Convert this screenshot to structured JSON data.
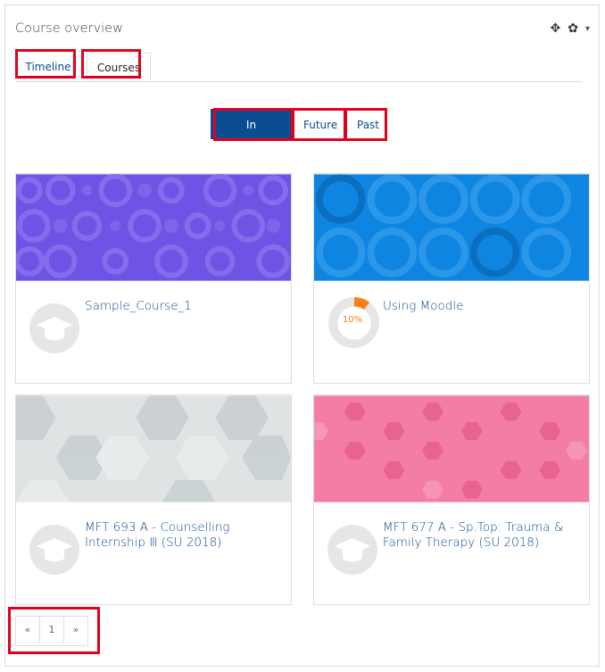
{
  "block": {
    "title": "Course overview",
    "controls": {
      "move_icon": "✥",
      "gear_icon": "✿",
      "caret_icon": "▾"
    }
  },
  "tabs": [
    {
      "label": "Timeline"
    },
    {
      "label": "Courses"
    }
  ],
  "filters": {
    "in_progress": "In progress",
    "future": "Future",
    "past": "Past"
  },
  "courses": [
    {
      "name": "Sample_Course_1",
      "theme": "purple",
      "progress_percent": null
    },
    {
      "name": "Using Moodle",
      "theme": "blue",
      "progress_percent": 10,
      "progress_label": "10%"
    },
    {
      "name": "MFT 693 A - Counselling Internship Ⅲ (SU 2018)",
      "line1": "MFT 693 A - Counselling",
      "line2": "Internship Ⅲ (SU 2018)",
      "theme": "gray"
    },
    {
      "name": "MFT 677 A - Sp.Top: Trauma & Family Therapy (SU 2018)",
      "line1": "MFT 677 A - Sp.Top: Trauma &",
      "line2": "Family Therapy (SU 2018)",
      "theme": "pink"
    }
  ],
  "pagination": {
    "prev": "«",
    "page": "1",
    "next": "»"
  },
  "colors": {
    "primary": "#0a4d92",
    "highlight": "#e0001b",
    "progress": "#f98012"
  }
}
